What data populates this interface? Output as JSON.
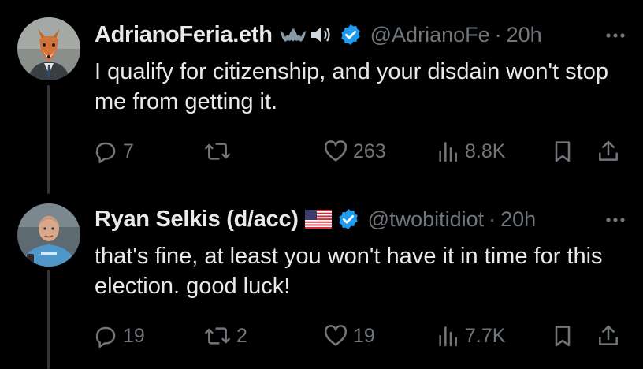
{
  "tweets": [
    {
      "display_name": "AdrianoFeria.eth",
      "name_emoji": [
        "bat-icon",
        "speaker-icon"
      ],
      "verified": true,
      "handle": "@AdrianoFe",
      "separator": "·",
      "time": "20h",
      "text": "I qualify for citizenship, and your disdain won't stop me from getting it.",
      "stats": {
        "replies": "7",
        "reposts": "",
        "likes": "263",
        "views": "8.8K"
      }
    },
    {
      "display_name": "Ryan Selkis (d/acc)",
      "name_emoji": [
        "us-flag-icon"
      ],
      "verified": true,
      "handle": "@twobitidiot",
      "separator": "·",
      "time": "20h",
      "text": "that's fine, at least you won't have it in time for this election. good luck!",
      "stats": {
        "replies": "19",
        "reposts": "2",
        "likes": "19",
        "views": "7.7K"
      }
    }
  ],
  "colors": {
    "background": "#000000",
    "text": "#e7e9ea",
    "secondary": "#71767b",
    "verified": "#1d9bf0",
    "thread_line": "#333639"
  }
}
